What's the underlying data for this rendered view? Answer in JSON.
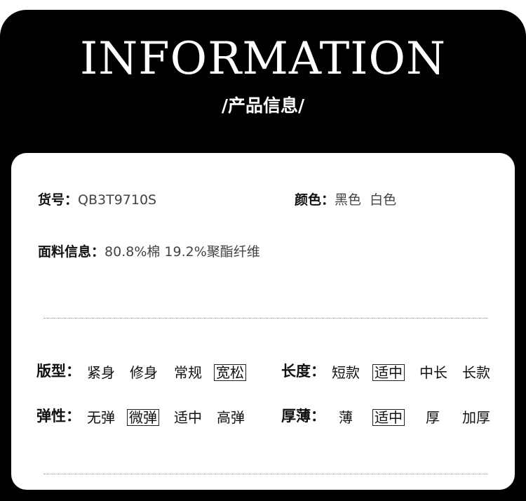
{
  "header": {
    "title": "INFORMATION",
    "subtitle": "/产品信息/"
  },
  "info": {
    "item_no_label": "货号：",
    "item_no_value": "QB3T9710S",
    "color_label": "颜色：",
    "color_value": "黑色  白色",
    "fabric_label": "面料信息：",
    "fabric_value": "80.8%棉 19.2%聚酯纤维"
  },
  "attributes": {
    "fit": {
      "label": "版型：",
      "options": [
        "紧身",
        "修身",
        "常规",
        "宽松"
      ],
      "selected": "宽松"
    },
    "length": {
      "label": "长度：",
      "options": [
        "短款",
        "适中",
        "中长",
        "长款"
      ],
      "selected": "适中"
    },
    "elasticity": {
      "label": "弹性：",
      "options": [
        "无弹",
        "微弹",
        "适中",
        "高弹"
      ],
      "selected": "微弹"
    },
    "thickness": {
      "label": "厚薄：",
      "options": [
        "薄",
        "适中",
        "厚",
        "加厚"
      ],
      "selected": "适中"
    }
  },
  "colors": {
    "background": "#000000",
    "panel": "#ffffff",
    "text": "#111111"
  }
}
